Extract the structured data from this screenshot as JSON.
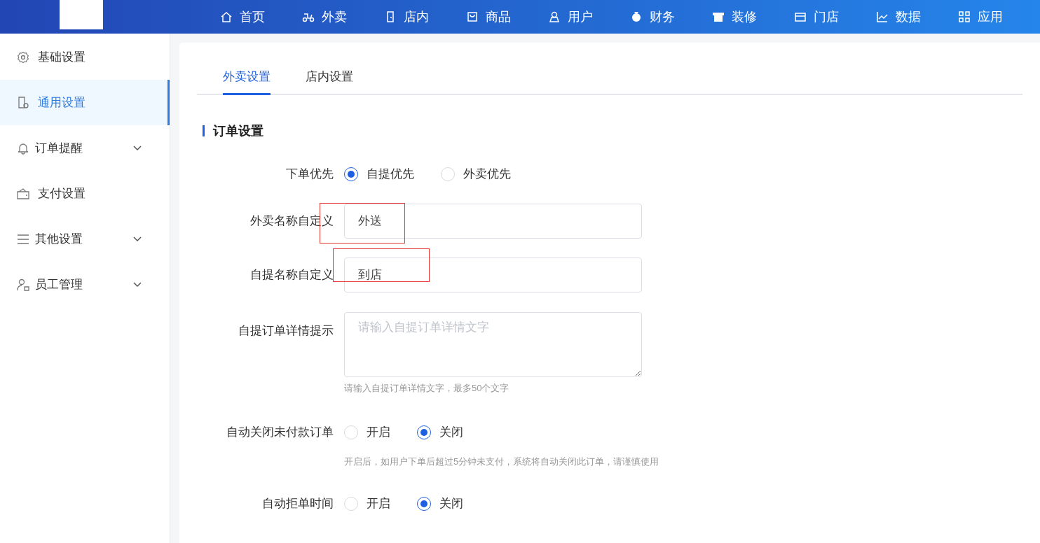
{
  "top_nav": [
    {
      "label": "首页",
      "selected": false
    },
    {
      "label": "外卖",
      "selected": false
    },
    {
      "label": "店内",
      "selected": false
    },
    {
      "label": "商品",
      "selected": false
    },
    {
      "label": "用户",
      "selected": false
    },
    {
      "label": "财务",
      "selected": false
    },
    {
      "label": "装修",
      "selected": false
    },
    {
      "label": "门店",
      "selected": false
    },
    {
      "label": "数据",
      "selected": false
    },
    {
      "label": "应用",
      "selected": false
    }
  ],
  "sidebar": {
    "items": [
      {
        "label": "基础设置",
        "selected": false,
        "expandable": false
      },
      {
        "label": "通用设置",
        "selected": true,
        "expandable": false
      },
      {
        "label": "订单提醒",
        "selected": false,
        "expandable": true
      },
      {
        "label": "支付设置",
        "selected": false,
        "expandable": false
      },
      {
        "label": "其他设置",
        "selected": false,
        "expandable": true
      },
      {
        "label": "员工管理",
        "selected": false,
        "expandable": true
      }
    ]
  },
  "tabs": [
    {
      "label": "外卖设置",
      "selected": true
    },
    {
      "label": "店内设置",
      "selected": false
    }
  ],
  "section_title": "订单设置",
  "form": [
    {
      "kind": "radio",
      "label": "下单优先",
      "options": [
        {
          "label": "自提优先",
          "selected": true
        },
        {
          "label": "外卖优先",
          "selected": false
        }
      ]
    },
    {
      "kind": "input",
      "label": "外卖名称自定义",
      "value": "外送",
      "highlighted": true
    },
    {
      "kind": "input",
      "label": "自提名称自定义",
      "value": "到店",
      "highlighted": true
    },
    {
      "kind": "textarea",
      "label": "自提订单详情提示",
      "placeholder": "请输入自提订单详情文字",
      "help": "请输入自提订单详情文字，最多50个文字"
    },
    {
      "kind": "radio",
      "label": "自动关闭未付款订单",
      "options": [
        {
          "label": "开启",
          "selected": false
        },
        {
          "label": "关闭",
          "selected": true
        }
      ],
      "help": "开启后，如用户下单后超过5分钟未支付，系统将自动关闭此订单，请谨慎使用"
    },
    {
      "kind": "radio",
      "label": "自动拒单时间",
      "options": [
        {
          "label": "开启",
          "selected": false
        },
        {
          "label": "关闭",
          "selected": true
        }
      ]
    }
  ]
}
